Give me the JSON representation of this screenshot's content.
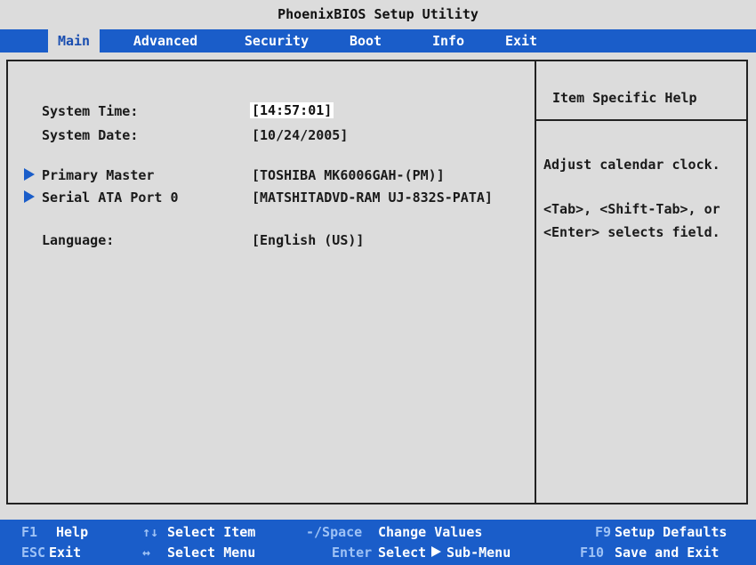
{
  "title": "PhoenixBIOS Setup Utility",
  "menu": [
    {
      "label": "Main",
      "active": true
    },
    {
      "label": "Advanced",
      "active": false
    },
    {
      "label": "Security",
      "active": false
    },
    {
      "label": "Boot",
      "active": false
    },
    {
      "label": "Info",
      "active": false
    },
    {
      "label": "Exit",
      "active": false
    }
  ],
  "settings": {
    "system_time_label": "System Time:",
    "system_time_value": "[14:57:01]",
    "system_date_label": "System Date:",
    "system_date_value": "[10/24/2005]",
    "primary_master_label": "Primary Master",
    "primary_master_value": "[TOSHIBA MK6006GAH-(PM)]",
    "sata_port_label": "Serial ATA Port 0",
    "sata_port_value": "[MATSHITADVD-RAM UJ-832S-PATA]",
    "language_label": "Language:",
    "language_value": "[English (US)]"
  },
  "help": {
    "title": "Item Specific Help",
    "line1": "Adjust calendar clock.",
    "line2": "<Tab>, <Shift-Tab>, or",
    "line3": "<Enter> selects field."
  },
  "status": {
    "f1_key": "F1",
    "f1_desc": "Help",
    "updown_key": "↑↓",
    "updown_desc": "Select Item",
    "space_key": "-/Space",
    "space_desc": "Change Values",
    "f9_key": "F9",
    "f9_desc": "Setup Defaults",
    "esc_key": "ESC",
    "esc_desc": "Exit",
    "leftright_key": "↔",
    "leftright_desc": "Select Menu",
    "enter_key": "Enter",
    "enter_desc_1": "Select",
    "enter_desc_2": "Sub-Menu",
    "f10_key": "F10",
    "f10_desc": "Save and Exit"
  },
  "colors": {
    "background": "#dcdcdc",
    "menu_blue": "#1a5dc9",
    "key_hint": "#9ec2f5",
    "text": "#1a1a1a"
  }
}
